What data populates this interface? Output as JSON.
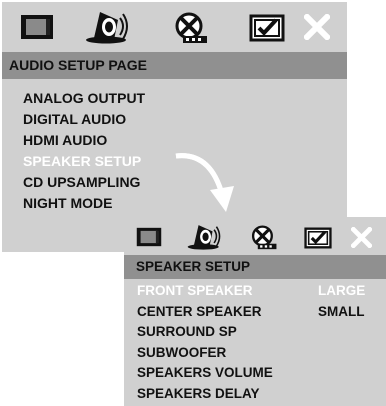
{
  "main_menu": {
    "icons": [
      "general-setup-icon",
      "audio-setup-icon",
      "video-setup-icon",
      "preference-icon",
      "exit-icon"
    ],
    "section_title": "AUDIO SETUP PAGE",
    "items": [
      {
        "label": "ANALOG OUTPUT",
        "selected": false
      },
      {
        "label": "DIGITAL AUDIO",
        "selected": false
      },
      {
        "label": "HDMI AUDIO",
        "selected": false
      },
      {
        "label": "SPEAKER SETUP",
        "selected": true
      },
      {
        "label": "CD UPSAMPLING",
        "selected": false
      },
      {
        "label": "NIGHT MODE",
        "selected": false
      }
    ]
  },
  "sub_menu": {
    "icons": [
      "general-setup-icon",
      "audio-setup-icon",
      "video-setup-icon",
      "preference-icon",
      "exit-icon"
    ],
    "section_title": "SPEAKER SETUP",
    "items": [
      {
        "label": "FRONT SPEAKER",
        "value": "LARGE",
        "selected": true
      },
      {
        "label": "CENTER SPEAKER",
        "value": "SMALL",
        "selected": false
      },
      {
        "label": "SURROUND SP",
        "value": "",
        "selected": false
      },
      {
        "label": "SUBWOOFER",
        "value": "",
        "selected": false
      },
      {
        "label": "SPEAKERS VOLUME",
        "value": "",
        "selected": false
      },
      {
        "label": "SPEAKERS DELAY",
        "value": "",
        "selected": false
      }
    ]
  },
  "colors": {
    "panel_bg": "#d0d0d0",
    "section_bar": "#909090",
    "text": "#111111",
    "selected_text": "#ffffff"
  }
}
